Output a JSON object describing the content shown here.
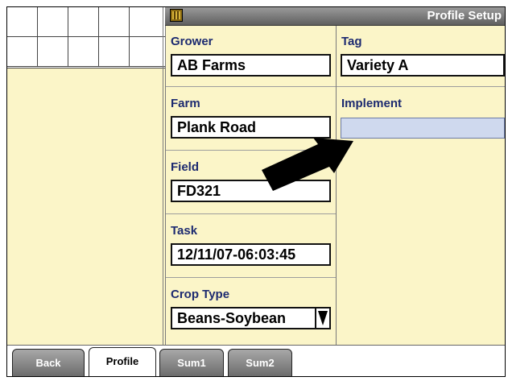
{
  "header": {
    "title": "Profile Setup",
    "icon": "grid-app-icon"
  },
  "left_column": [
    {
      "label": "Grower",
      "value": "AB Farms"
    },
    {
      "label": "Farm",
      "value": "Plank Road"
    },
    {
      "label": "Field",
      "value": "FD321"
    },
    {
      "label": "Task",
      "value": "12/11/07-06:03:45"
    },
    {
      "label": "Crop Type",
      "value": "Beans-Soybean"
    }
  ],
  "right_column": [
    {
      "label": "Tag",
      "value": "Variety A"
    },
    {
      "label": "Implement",
      "value": ""
    }
  ],
  "tabs": [
    {
      "label": "Back"
    },
    {
      "label": "Profile",
      "active": true
    },
    {
      "label": "Sum1"
    },
    {
      "label": "Sum2"
    }
  ],
  "colors": {
    "background": "#fbf5c8",
    "label_text": "#1c2a70",
    "empty_field": "#cfd9ee"
  }
}
